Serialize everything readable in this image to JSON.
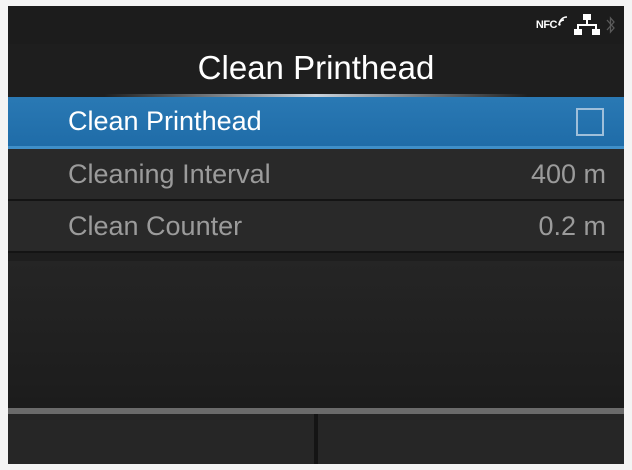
{
  "status_bar": {
    "nfc_label": "NFC",
    "icons": [
      "nfc-icon",
      "network-icon",
      "bluetooth-icon"
    ]
  },
  "title": "Clean Printhead",
  "menu": {
    "items": [
      {
        "label": "Clean Printhead",
        "value": "",
        "control": "checkbox",
        "checked": false,
        "selected": true
      },
      {
        "label": "Cleaning Interval",
        "value": "400 m"
      },
      {
        "label": "Clean Counter",
        "value": "0.2 m"
      }
    ]
  },
  "softkeys": {
    "left": "",
    "right": ""
  },
  "colors": {
    "selected_row": "#2a79b4",
    "background": "#1e1e1e",
    "inactive_text": "#9b9b9b"
  }
}
